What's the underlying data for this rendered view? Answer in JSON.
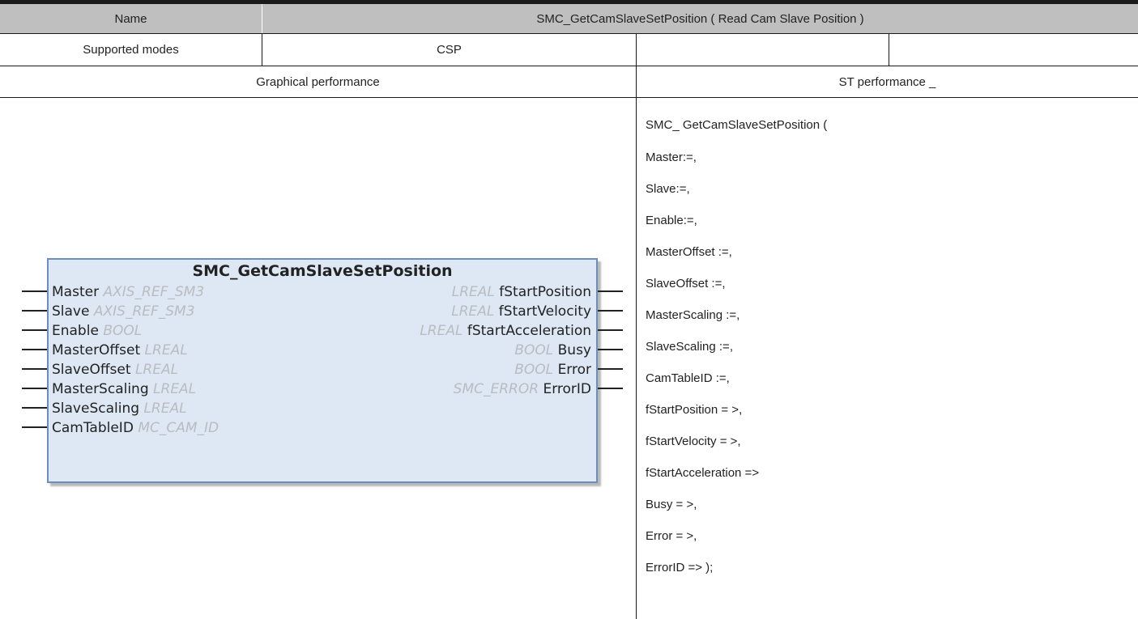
{
  "header": {
    "name_label": "Name",
    "name_value": "SMC_GetCamSlaveSetPosition ( Read Cam Slave Position )"
  },
  "modes": {
    "label": "Supported modes",
    "value": "CSP",
    "extra1": "",
    "extra2": ""
  },
  "section": {
    "graphical": "Graphical performance",
    "st": "ST performance _"
  },
  "function_block": {
    "title": "SMC_GetCamSlaveSetPosition",
    "inputs": [
      {
        "name": "Master",
        "type": "AXIS_REF_SM3"
      },
      {
        "name": "Slave",
        "type": "AXIS_REF_SM3"
      },
      {
        "name": "Enable",
        "type": "BOOL"
      },
      {
        "name": "MasterOffset",
        "type": "LREAL"
      },
      {
        "name": "SlaveOffset",
        "type": "LREAL"
      },
      {
        "name": "MasterScaling",
        "type": "LREAL"
      },
      {
        "name": "SlaveScaling",
        "type": "LREAL"
      },
      {
        "name": "CamTableID",
        "type": "MC_CAM_ID"
      }
    ],
    "outputs": [
      {
        "name": "fStartPosition",
        "type": "LREAL"
      },
      {
        "name": "fStartVelocity",
        "type": "LREAL"
      },
      {
        "name": "fStartAcceleration",
        "type": "LREAL"
      },
      {
        "name": "Busy",
        "type": "BOOL"
      },
      {
        "name": "Error",
        "type": "BOOL"
      },
      {
        "name": "ErrorID",
        "type": "SMC_ERROR"
      }
    ]
  },
  "st_code": [
    "SMC_ GetCamSlaveSetPosition (",
    "Master:=,",
    "Slave:=,",
    "Enable:=,",
    "MasterOffset :=,",
    "SlaveOffset :=,",
    "MasterScaling :=,",
    "SlaveScaling :=,",
    "CamTableID :=,",
    "fStartPosition = >,",
    "fStartVelocity = >,",
    "fStartAcceleration =>",
    "Busy = >,",
    "Error = >,",
    "ErrorID => );"
  ]
}
